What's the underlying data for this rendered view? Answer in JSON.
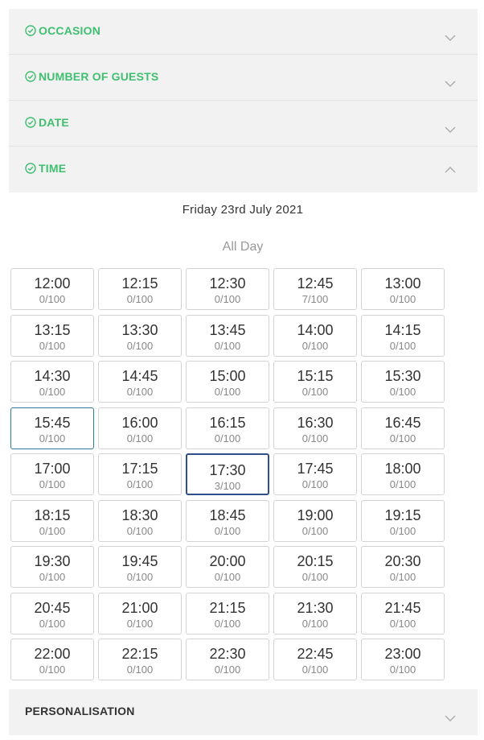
{
  "accordion": {
    "occasion_label": "OCCASION",
    "guests_label": "NUMBER OF GUESTS",
    "date_label": "DATE",
    "time_label": "TIME",
    "personalisation_label": "PERSONALISATION"
  },
  "time_section": {
    "date_heading": "Friday 23rd July 2021",
    "period": "All Day",
    "selected_time": "17:30",
    "slots": [
      {
        "time": "12:00",
        "count": "0/100"
      },
      {
        "time": "12:15",
        "count": "0/100"
      },
      {
        "time": "12:30",
        "count": "0/100"
      },
      {
        "time": "12:45",
        "count": "7/100"
      },
      {
        "time": "13:00",
        "count": "0/100"
      },
      {
        "time": "13:15",
        "count": "0/100"
      },
      {
        "time": "13:30",
        "count": "0/100"
      },
      {
        "time": "13:45",
        "count": "0/100"
      },
      {
        "time": "14:00",
        "count": "0/100"
      },
      {
        "time": "14:15",
        "count": "0/100"
      },
      {
        "time": "14:30",
        "count": "0/100"
      },
      {
        "time": "14:45",
        "count": "0/100"
      },
      {
        "time": "15:00",
        "count": "0/100"
      },
      {
        "time": "15:15",
        "count": "0/100"
      },
      {
        "time": "15:30",
        "count": "0/100"
      },
      {
        "time": "15:45",
        "count": "0/100"
      },
      {
        "time": "16:00",
        "count": "0/100"
      },
      {
        "time": "16:15",
        "count": "0/100"
      },
      {
        "time": "16:30",
        "count": "0/100"
      },
      {
        "time": "16:45",
        "count": "0/100"
      },
      {
        "time": "17:00",
        "count": "0/100"
      },
      {
        "time": "17:15",
        "count": "0/100"
      },
      {
        "time": "17:30",
        "count": "3/100"
      },
      {
        "time": "17:45",
        "count": "0/100"
      },
      {
        "time": "18:00",
        "count": "0/100"
      },
      {
        "time": "18:15",
        "count": "0/100"
      },
      {
        "time": "18:30",
        "count": "0/100"
      },
      {
        "time": "18:45",
        "count": "0/100"
      },
      {
        "time": "19:00",
        "count": "0/100"
      },
      {
        "time": "19:15",
        "count": "0/100"
      },
      {
        "time": "19:30",
        "count": "0/100"
      },
      {
        "time": "19:45",
        "count": "0/100"
      },
      {
        "time": "20:00",
        "count": "0/100"
      },
      {
        "time": "20:15",
        "count": "0/100"
      },
      {
        "time": "20:30",
        "count": "0/100"
      },
      {
        "time": "20:45",
        "count": "0/100"
      },
      {
        "time": "21:00",
        "count": "0/100"
      },
      {
        "time": "21:15",
        "count": "0/100"
      },
      {
        "time": "21:30",
        "count": "0/100"
      },
      {
        "time": "21:45",
        "count": "0/100"
      },
      {
        "time": "22:00",
        "count": "0/100"
      },
      {
        "time": "22:15",
        "count": "0/100"
      },
      {
        "time": "22:30",
        "count": "0/100"
      },
      {
        "time": "22:45",
        "count": "0/100"
      },
      {
        "time": "23:00",
        "count": "0/100"
      }
    ]
  },
  "colors": {
    "complete_green": "#3fbf6f",
    "selected_border": "#2f4f8a",
    "hover_border": "#2a7d95"
  },
  "icons": {
    "completed_step": "check-circle-icon",
    "collapsed": "chevron-down-icon",
    "expanded": "chevron-up-icon"
  }
}
